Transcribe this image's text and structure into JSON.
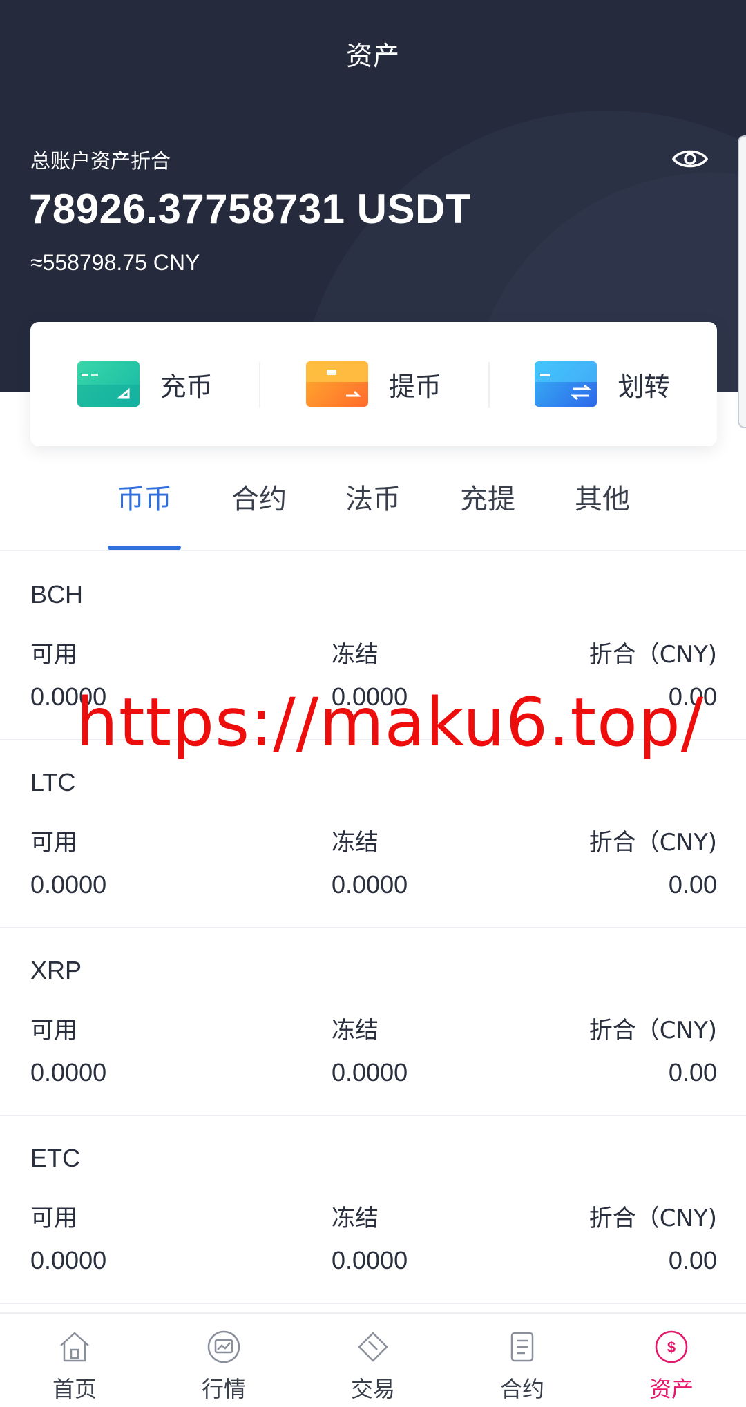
{
  "header": {
    "title": "资产",
    "total_label": "总账户资产折合",
    "total_value": "78926.37758731 USDT",
    "total_cny": "≈558798.75 CNY"
  },
  "actions": [
    {
      "label": "充币",
      "icon": "deposit-card-icon"
    },
    {
      "label": "提币",
      "icon": "withdraw-wallet-icon"
    },
    {
      "label": "划转",
      "icon": "transfer-card-icon"
    }
  ],
  "tabs": [
    {
      "label": "币币",
      "active": true
    },
    {
      "label": "合约",
      "active": false
    },
    {
      "label": "法币",
      "active": false
    },
    {
      "label": "充提",
      "active": false
    },
    {
      "label": "其他",
      "active": false
    }
  ],
  "asset_headers": {
    "available": "可用",
    "frozen": "冻结",
    "value": "折合（CNY)"
  },
  "assets": [
    {
      "coin": "BCH",
      "available": "0.0000",
      "frozen": "0.0000",
      "value": "0.00"
    },
    {
      "coin": "LTC",
      "available": "0.0000",
      "frozen": "0.0000",
      "value": "0.00"
    },
    {
      "coin": "XRP",
      "available": "0.0000",
      "frozen": "0.0000",
      "value": "0.00"
    },
    {
      "coin": "ETC",
      "available": "0.0000",
      "frozen": "0.0000",
      "value": "0.00"
    }
  ],
  "watermark": "https://maku6.top/",
  "nav": [
    {
      "label": "首页",
      "icon": "home-icon"
    },
    {
      "label": "行情",
      "icon": "market-chart-icon"
    },
    {
      "label": "交易",
      "icon": "trade-diamond-icon"
    },
    {
      "label": "合约",
      "icon": "contract-document-icon"
    },
    {
      "label": "资产",
      "icon": "assets-dollar-icon",
      "active": true
    }
  ],
  "colors": {
    "header_bg": "#252b3d",
    "tab_active": "#2f6fde",
    "nav_active": "#e6186c",
    "watermark": "#ee0d0d"
  }
}
